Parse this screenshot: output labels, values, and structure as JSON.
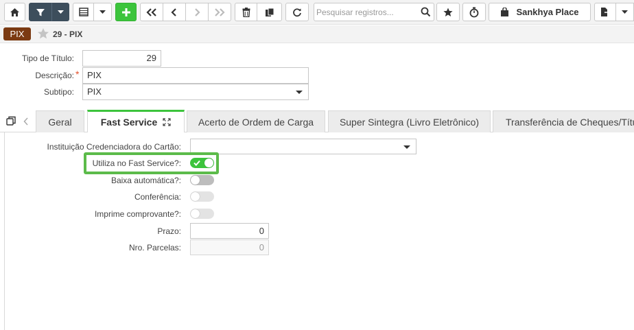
{
  "toolbar": {
    "search_placeholder": "Pesquisar registros...",
    "place_label": "Sankhya Place"
  },
  "record": {
    "badge": "PIX",
    "title": "29 - PIX"
  },
  "form": {
    "tipo_label": "Tipo de Título:",
    "tipo_value": "29",
    "descricao_label": "Descrição:",
    "required_mark": "*",
    "descricao_value": "PIX",
    "subtipo_label": "Subtipo:",
    "subtipo_value": "PIX"
  },
  "tabs": [
    {
      "label": "Geral"
    },
    {
      "label": "Fast Service"
    },
    {
      "label": "Acerto de Ordem de Carga"
    },
    {
      "label": "Super Sintegra (Livro Eletrônico)"
    },
    {
      "label": "Transferência de Cheques/Títu"
    }
  ],
  "fast_service": {
    "instituicao_label": "Instituição Credenciadora do Cartão:",
    "instituicao_value": "",
    "utiliza_label": "Utiliza no Fast Service?:",
    "utiliza_on": true,
    "baixa_label": "Baixa automática?:",
    "baixa_on": false,
    "conferencia_label": "Conferência:",
    "conferencia_on": false,
    "imprime_label": "Imprime comprovante?:",
    "imprime_on": false,
    "prazo_label": "Prazo:",
    "prazo_value": "0",
    "parcelas_label": "Nro. Parcelas:",
    "parcelas_value": "0"
  },
  "colors": {
    "accent_green": "#3cc43c",
    "badge_brown": "#7b3a12",
    "dark_button": "#3d4e5c",
    "highlight_green": "#5cbb4a"
  }
}
